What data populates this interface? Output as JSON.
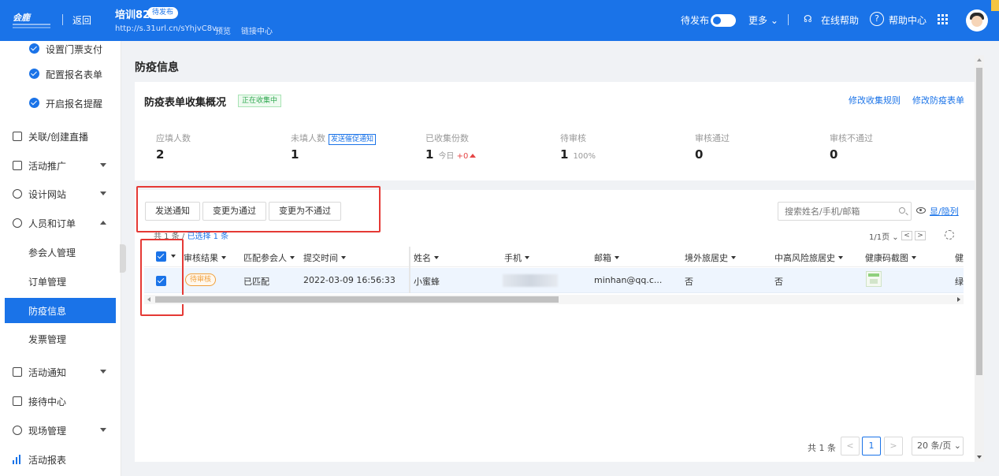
{
  "header": {
    "logo_text": "会鹿",
    "back": "返回",
    "event_title": "培训82",
    "status_badge": "待发布",
    "event_url": "http://s.31url.cn/sYhjvC8v",
    "preview": "预览",
    "link_center": "链接中心",
    "publish_toggle_label": "待发布",
    "more": "更多",
    "online_help": "在线帮助",
    "help_center": "帮助中心"
  },
  "sidebar": {
    "sub_items": [
      "设置门票支付",
      "配置报名表单",
      "开启报名提醒"
    ],
    "items": [
      {
        "label": "关联/创建直播",
        "icon": "live-icon"
      },
      {
        "label": "活动推广",
        "icon": "promote-icon"
      },
      {
        "label": "设计网站",
        "icon": "website-icon"
      },
      {
        "label": "人员和订单",
        "icon": "people-icon"
      },
      {
        "label": "参会人管理"
      },
      {
        "label": "订单管理"
      },
      {
        "label": "防疫信息"
      },
      {
        "label": "发票管理"
      },
      {
        "label": "活动通知",
        "icon": "notify-icon"
      },
      {
        "label": "接待中心",
        "icon": "reception-icon"
      },
      {
        "label": "现场管理",
        "icon": "onsite-icon"
      },
      {
        "label": "活动报表",
        "icon": "report-icon"
      }
    ],
    "active_item": "防疫信息"
  },
  "main": {
    "page_title": "防疫信息",
    "section_title": "防疫表单收集概况",
    "collecting_tag": "正在收集中",
    "edit_rules": "修改收集规则",
    "edit_form": "修改防疫表单",
    "stats": [
      {
        "label": "应填人数",
        "value": "2"
      },
      {
        "label": "未填人数",
        "value": "1",
        "action": "发送催促通知"
      },
      {
        "label": "已收集份数",
        "value": "1",
        "today_label": "今日",
        "today_change": "+0"
      },
      {
        "label": "待审核",
        "value": "1",
        "percent": "100%"
      },
      {
        "label": "审核通过",
        "value": "0"
      },
      {
        "label": "审核不通过",
        "value": "0"
      }
    ],
    "buttons": [
      "发送通知",
      "变更为通过",
      "变更为不通过"
    ],
    "search_placeholder": "搜索姓名/手机/邮箱",
    "show_hide": "显/隐列",
    "count_prefix": "共 1 条 / ",
    "count_selected": "已选择 1 条",
    "page_indicator": "1/1页",
    "columns": [
      "审核结果",
      "匹配参会人",
      "提交时间",
      "姓名",
      "手机",
      "邮箱",
      "境外旅居史",
      "中高风险旅居史",
      "健康码截图",
      "健"
    ],
    "rows": [
      {
        "review": "待审核",
        "match": "已匹配",
        "submit_time": "2022-03-09 16:56:33",
        "name": "小蜜蜂",
        "phone": "",
        "email": "minhan@qq.c...",
        "overseas": "否",
        "risk": "否",
        "health_code": "health-code-thumbnail",
        "last": "绿"
      }
    ],
    "total": "共 1 条",
    "current_page": "1",
    "prev": "<",
    "next": ">",
    "per_page": "20 条/页"
  },
  "colors": {
    "primary": "#1a73e8",
    "highlight_box": "#e53935",
    "pending_orange": "#f0a03c",
    "collecting_green": "#2fa84f"
  }
}
